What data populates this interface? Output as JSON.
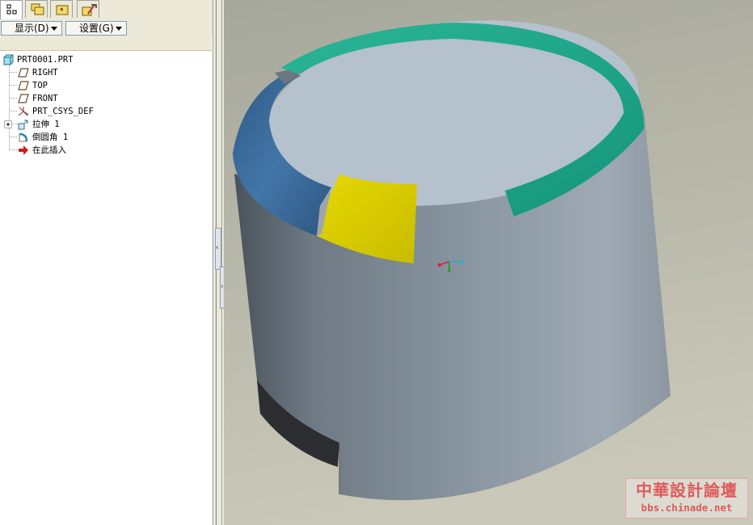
{
  "navigator": {
    "tabs": [
      {
        "icon": "model-tree-icon"
      },
      {
        "icon": "folder-browser-icon"
      },
      {
        "icon": "favorites-icon"
      },
      {
        "icon": "connections-icon"
      }
    ],
    "show_label": "显示(D)",
    "settings_label": "设置(G)",
    "tree": [
      {
        "label": "PRT0001.PRT",
        "icon": "part-icon"
      },
      {
        "label": "RIGHT",
        "icon": "datum-plane-icon"
      },
      {
        "label": "TOP",
        "icon": "datum-plane-icon"
      },
      {
        "label": "FRONT",
        "icon": "datum-plane-icon"
      },
      {
        "label": "PRT_CSYS_DEF",
        "icon": "csys-icon"
      },
      {
        "label": "拉伸 1",
        "icon": "extrude-icon"
      },
      {
        "label": "倒圆角 1",
        "icon": "round-icon"
      },
      {
        "label": "在此插入",
        "icon": "insert-here-arrow-icon"
      }
    ]
  },
  "viewport": {
    "background": "#c2c0b0",
    "cylinder_color": "#7d8994",
    "top_face_color": "#b4c0cc",
    "highlight_colors": [
      "#3a6a98",
      "#dccf00",
      "#21a58a"
    ]
  },
  "watermark": {
    "title": "中華設計論壇",
    "url": "bbs.chinade.net"
  }
}
